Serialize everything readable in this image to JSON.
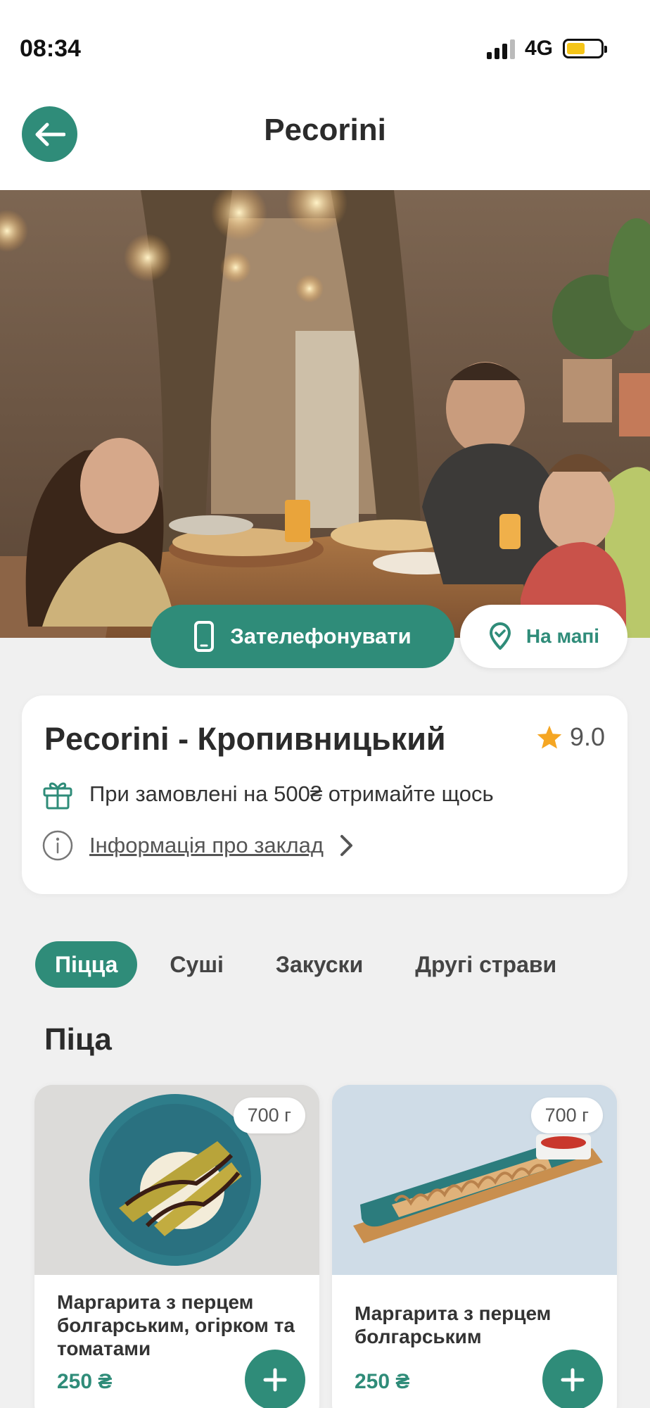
{
  "status_bar": {
    "time": "08:34",
    "network": "4G"
  },
  "header": {
    "title": "Pecorini",
    "back_icon": "arrow-left-icon"
  },
  "actions": {
    "call_label": "Зателефонувати",
    "call_icon": "phone-icon",
    "map_label": "На мапі",
    "map_icon": "map-pin-icon"
  },
  "venue": {
    "name": "Pecorini - Кропивницький",
    "rating": "9.0",
    "rating_icon": "star-icon",
    "promo_text": "При замовлені на 500₴ отримайте щось",
    "promo_icon": "gift-icon",
    "info_link": "Інформація про заклад",
    "info_icon": "info-icon"
  },
  "categories": [
    {
      "label": "Піцца",
      "active": true
    },
    {
      "label": "Суші",
      "active": false
    },
    {
      "label": "Закуски",
      "active": false
    },
    {
      "label": "Другі страви",
      "active": false
    }
  ],
  "section_title": "Піца",
  "products": [
    {
      "name": "Маргарита з перцем болгарським, огірком та томатами",
      "weight": "700 г",
      "price": "250 ₴"
    },
    {
      "name": "Маргарита з перцем болгарським",
      "weight": "700 г",
      "price": "250 ₴"
    }
  ],
  "colors": {
    "accent": "#2f8c79",
    "background": "#f0f0f0",
    "star": "#f5a623",
    "battery": "#f5c518"
  }
}
